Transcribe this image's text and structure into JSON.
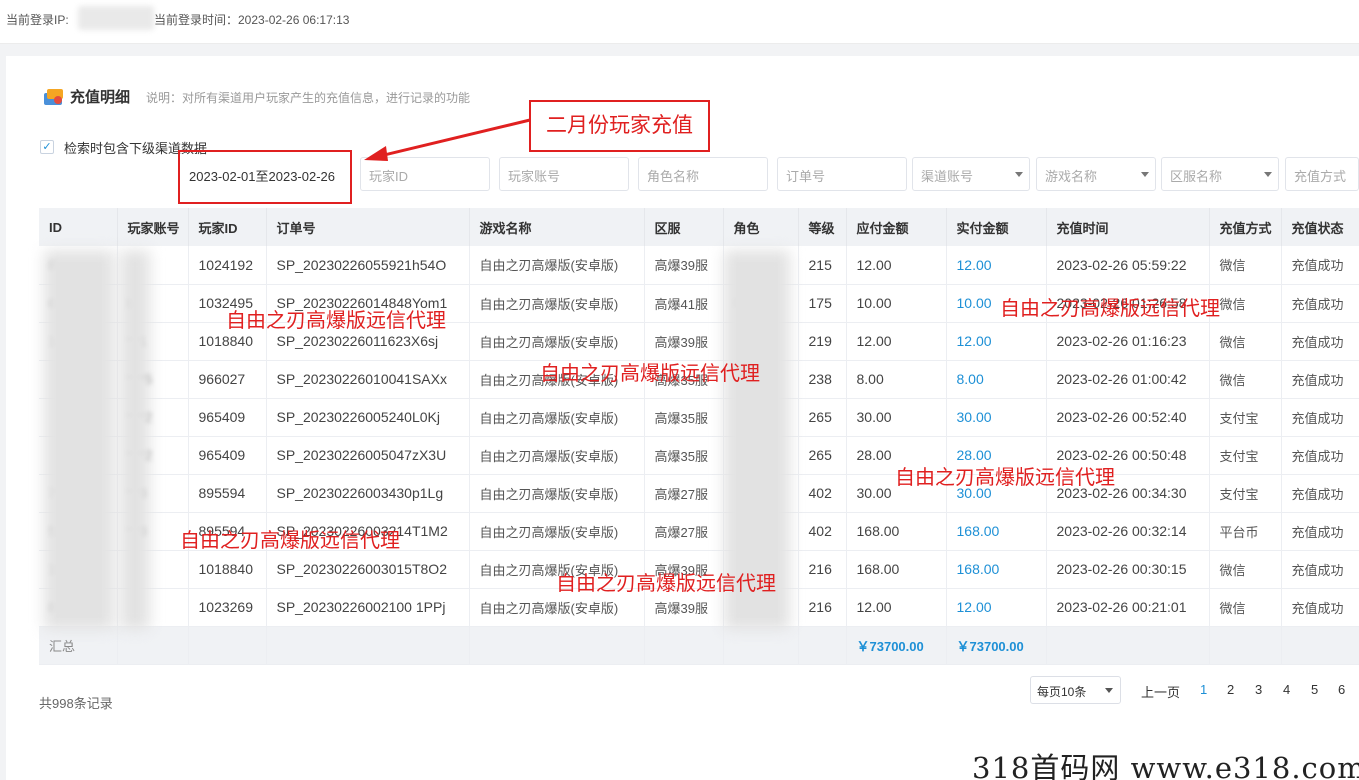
{
  "topbar": {
    "ip_label": "当前登录IP:",
    "time_label": "当前登录时间：2023-02-26 06:17:13"
  },
  "heading": {
    "title": "充值明细",
    "desc": "说明：对所有渠道用户玩家产生的充值信息，进行记录的功能"
  },
  "checkbox": {
    "label": "检索时包含下级渠道数据",
    "checked": true
  },
  "filters": {
    "date_range": "2023-02-01至2023-02-26",
    "player_id": "玩家ID",
    "player_account": "玩家账号",
    "role_name": "角色名称",
    "order_no": "订单号",
    "channel_account": "渠道账号",
    "game_name": "游戏名称",
    "server_name": "区服名称",
    "pay_method": "充值方式"
  },
  "table": {
    "headers": [
      "ID",
      "玩家账号",
      "玩家ID",
      "订单号",
      "游戏名称",
      "区服",
      "角色",
      "等级",
      "应付金额",
      "实付金额",
      "充值时间",
      "充值方式",
      "充值状态"
    ],
    "rows": [
      [
        "8",
        "",
        "1024192",
        "SP_20230226055921h54O",
        "自由之刃高爆版(安卓版)",
        "高爆39服",
        "",
        "215",
        "12.00",
        "12.00",
        "2023-02-26 05:59:22",
        "微信",
        "充值成功"
      ],
      [
        "6",
        "b",
        "1032495",
        "SP_20230226014848Yom1",
        "自由之刃高爆版(安卓版)",
        "高爆41服",
        "F",
        "175",
        "10.00",
        "10.00",
        "2023-02-26 01:26:58",
        "微信",
        "充值成功"
      ],
      [
        "1",
        "**1",
        "1018840",
        "SP_20230226011623X6sj",
        "自由之刃高爆版(安卓版)",
        "高爆39服",
        "",
        "219",
        "12.00",
        "12.00",
        "2023-02-26 01:16:23",
        "微信",
        "充值成功"
      ],
      [
        "",
        "***5",
        "966027",
        "SP_20230226010041SAXx",
        "自由之刃高爆版(安卓版)",
        "高爆35服",
        "",
        "238",
        "8.00",
        "8.00",
        "2023-02-26 01:00:42",
        "微信",
        "充值成功"
      ],
      [
        "",
        "***2",
        "965409",
        "SP_20230226005240L0Kj",
        "自由之刃高爆版(安卓版)",
        "高爆35服",
        "",
        "265",
        "30.00",
        "30.00",
        "2023-02-26 00:52:40",
        "支付宝",
        "充值成功"
      ],
      [
        "",
        "***2",
        "965409",
        "SP_20230226005047zX3U",
        "自由之刃高爆版(安卓版)",
        "高爆35服",
        "",
        "265",
        "28.00",
        "28.00",
        "2023-02-26 00:50:48",
        "支付宝",
        "充值成功"
      ],
      [
        "7",
        "**3",
        "895594",
        "SP_20230226003430p1Lg",
        "自由之刃高爆版(安卓版)",
        "高爆27服",
        "",
        "402",
        "30.00",
        "30.00",
        "2023-02-26 00:34:30",
        "支付宝",
        "充值成功"
      ],
      [
        "52",
        "**3",
        "895594",
        "SP_20230226003214T1M2",
        "自由之刃高爆版(安卓版)",
        "高爆27服",
        "",
        "402",
        "168.00",
        "168.00",
        "2023-02-26 00:32:14",
        "平台币",
        "充值成功"
      ],
      [
        "18",
        "",
        "1018840",
        "SP_20230226003015T8O2",
        "自由之刃高爆版(安卓版)",
        "高爆39服",
        "",
        "216",
        "168.00",
        "168.00",
        "2023-02-26 00:30:15",
        "微信",
        "充值成功"
      ],
      [
        "8",
        "",
        "1023269",
        "SP_20230226002100 1PPj",
        "自由之刃高爆版(安卓版)",
        "高爆39服",
        "",
        "216",
        "12.00",
        "12.00",
        "2023-02-26 00:21:01",
        "微信",
        "充值成功"
      ]
    ],
    "summary_label": "汇总",
    "summary_payable": "￥73700.00",
    "summary_paid": "￥73700.00"
  },
  "footer": {
    "total": "共998条记录",
    "page_size": "每页10条",
    "prev": "上一页",
    "pages": [
      "1",
      "2",
      "3",
      "4",
      "5",
      "6"
    ],
    "current_page": "1"
  },
  "annotations": {
    "callout": "二月份玩家充值",
    "watermark": "自由之刃高爆版远信代理",
    "corner_mark": "318首码网 www.e318.com"
  }
}
